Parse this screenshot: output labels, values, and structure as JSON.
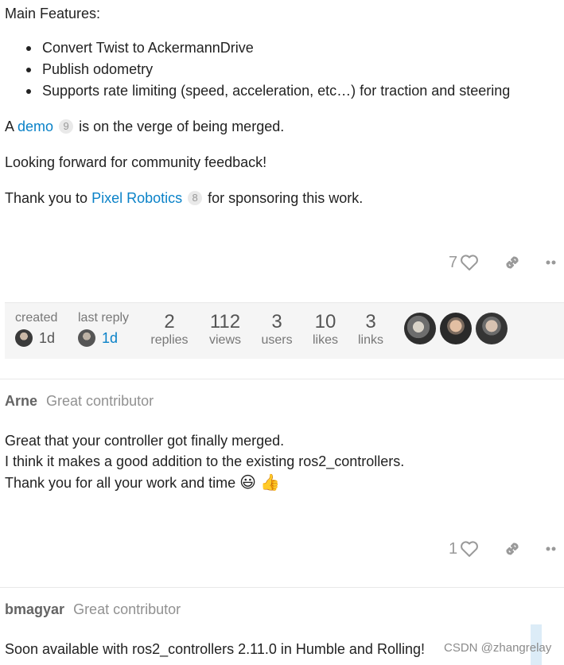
{
  "post1": {
    "features_heading": "Main Features:",
    "features": [
      "Convert Twist to AckermannDrive",
      "Publish odometry",
      "Supports rate limiting (speed, acceleration, etc…) for traction and steering"
    ],
    "demo_line": {
      "before": "A ",
      "link": "demo",
      "badge": "9",
      "after": " is on the verge of being merged."
    },
    "feedback_line": "Looking forward for community feedback!",
    "thanks_line": {
      "before": "Thank you to ",
      "link": "Pixel Robotics",
      "badge": "8",
      "after": " for sponsoring this work."
    },
    "like_count": "7"
  },
  "topic_map": {
    "created": {
      "label": "created",
      "value": "1d"
    },
    "last_reply": {
      "label": "last reply",
      "value": "1d"
    },
    "stats": [
      {
        "number": "2",
        "label": "replies"
      },
      {
        "number": "112",
        "label": "views"
      },
      {
        "number": "3",
        "label": "users"
      },
      {
        "number": "10",
        "label": "likes"
      },
      {
        "number": "3",
        "label": "links"
      }
    ]
  },
  "post2": {
    "author": "Arne",
    "title": "Great contributor",
    "lines": [
      "Great that your controller got finally merged.",
      "I think it makes a good addition to the existing ros2_controllers.",
      "Thank you for all your work and time"
    ],
    "emojis": [
      "😃",
      "👍"
    ],
    "like_count": "1"
  },
  "post3": {
    "author": "bmagyar",
    "title": "Great contributor",
    "line": "Soon available with ros2_controllers 2.11.0 in Humble and Rolling!"
  },
  "watermark": "CSDN @zhangrelay",
  "icons": [
    "heart-icon",
    "link-icon",
    "more-icon",
    "avatar"
  ]
}
